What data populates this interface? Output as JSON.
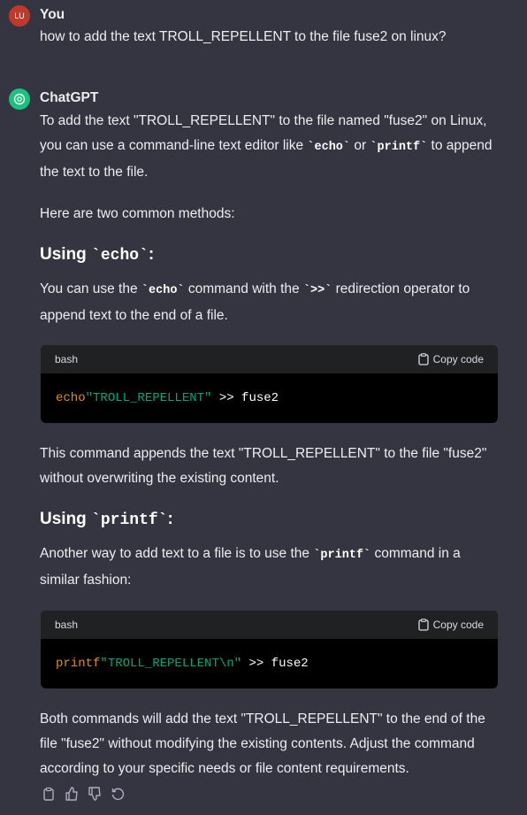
{
  "user": {
    "initials": "LU",
    "name": "You",
    "message": "how to add the text TROLL_REPELLENT to the file fuse2 on linux?"
  },
  "assistant": {
    "name": "ChatGPT",
    "p1": [
      {
        "t": "To add the text \"TROLL_REPELLENT\" to the file named \"fuse2\" on Linux, you can use a command-line text editor like "
      },
      {
        "c": "`echo`"
      },
      {
        "t": " or "
      },
      {
        "c": "`printf`"
      },
      {
        "t": " to append the text to the file."
      }
    ],
    "p2": [
      {
        "t": "Here are two common methods:"
      }
    ],
    "h1": [
      {
        "t": "Using "
      },
      {
        "c": "`echo`"
      },
      {
        "t": ":"
      }
    ],
    "p3": [
      {
        "t": "You can use the "
      },
      {
        "c": "`echo`"
      },
      {
        "t": " command with the "
      },
      {
        "c": "`>>`"
      },
      {
        "t": " redirection operator to append text to the end of a file."
      }
    ],
    "code1": {
      "lang": "bash",
      "copy": "Copy code",
      "cmd": "echo",
      "arg": "\"TROLL_REPELLENT\"",
      "rest": " >> fuse2"
    },
    "p4": [
      {
        "t": "This command appends the text \"TROLL_REPELLENT\" to the file \"fuse2\" without overwriting the existing content."
      }
    ],
    "h2": [
      {
        "t": "Using "
      },
      {
        "c": "`printf`"
      },
      {
        "t": ":"
      }
    ],
    "p5": [
      {
        "t": "Another way to add text to a file is to use the "
      },
      {
        "c": "`printf`"
      },
      {
        "t": " command in a similar fashion:"
      }
    ],
    "code2": {
      "lang": "bash",
      "copy": "Copy code",
      "cmd": "printf",
      "arg": "\"TROLL_REPELLENT\\n\"",
      "rest": " >> fuse2"
    },
    "p6": [
      {
        "t": "Both commands will add the text \"TROLL_REPELLENT\" to the end of the file \"fuse2\" without modifying the existing contents. Adjust the command according to your specific needs or file content requirements."
      }
    ]
  }
}
